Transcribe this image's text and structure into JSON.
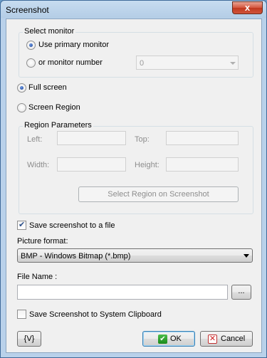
{
  "window": {
    "title": "Screenshot",
    "close_glyph": "x"
  },
  "monitor": {
    "group_label": "Select monitor",
    "use_primary_label": "Use primary monitor",
    "use_primary_checked": true,
    "monitor_number_label": "or monitor number",
    "monitor_number_value": "0"
  },
  "capture": {
    "full_screen_label": "Full screen",
    "full_screen_checked": true,
    "screen_region_label": "Screen Region",
    "screen_region_checked": false
  },
  "region": {
    "group_label": "Region Parameters",
    "left_label": "Left:",
    "top_label": "Top:",
    "width_label": "Width:",
    "height_label": "Height:",
    "select_button_label": "Select Region on Screenshot"
  },
  "save": {
    "save_to_file_label": "Save screenshot to a file",
    "save_to_file_checked": true,
    "picture_format_label": "Picture format:",
    "picture_format_value": "BMP - Windows Bitmap (*.bmp)",
    "file_name_label": "File Name :",
    "file_name_value": "",
    "browse_label": "...",
    "clipboard_label": "Save Screenshot to System Clipboard",
    "clipboard_checked": false
  },
  "footer": {
    "variables_label": "{V}",
    "ok_label": "OK",
    "cancel_label": "Cancel"
  },
  "icons": {
    "ok": "check-icon",
    "cancel": "x-icon"
  }
}
